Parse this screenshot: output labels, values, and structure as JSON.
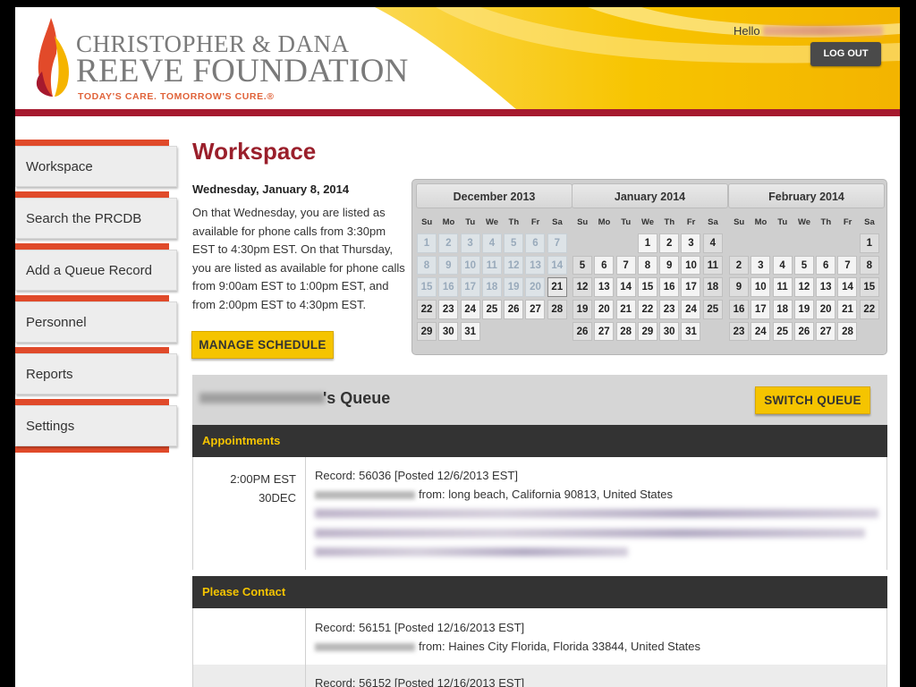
{
  "header": {
    "logo_line1": "CHRISTOPHER & DANA",
    "logo_line2": "REEVE FOUNDATION",
    "logo_tagline": "TODAY'S CARE. TOMORROW'S CURE.®",
    "hello_label": "Hello",
    "logout_label": "LOG OUT",
    "colors": {
      "accent_red": "#a6192e",
      "yellow": "#f5c400",
      "title_red": "#9a1f2b"
    }
  },
  "sidebar": {
    "items": [
      {
        "label": "Workspace"
      },
      {
        "label": "Search the PRCDB"
      },
      {
        "label": "Add a Queue Record"
      },
      {
        "label": "Personnel"
      },
      {
        "label": "Reports"
      },
      {
        "label": "Settings"
      }
    ]
  },
  "main": {
    "title": "Workspace",
    "date_heading": "Wednesday, January 8, 2014",
    "availability_text": "On that Wednesday, you are listed as available for phone calls from 3:30pm EST to 4:30pm EST. On that Thursday, you are listed as available for phone calls from 9:00am EST to 1:00pm EST, and from 2:00pm EST to 4:30pm EST.",
    "manage_schedule_label": "MANAGE SCHEDULE"
  },
  "calendar": {
    "weekday_labels": [
      "Su",
      "Mo",
      "Tu",
      "We",
      "Th",
      "Fr",
      "Sa"
    ],
    "months": [
      {
        "title": "December 2013",
        "first_weekday": 0,
        "days": 31,
        "past_until": 20,
        "today": 21
      },
      {
        "title": "January 2014",
        "first_weekday": 3,
        "days": 31
      },
      {
        "title": "February 2014",
        "first_weekday": 6,
        "days": 28
      }
    ]
  },
  "queue": {
    "title_suffix": "'s Queue",
    "switch_label": "SWITCH QUEUE",
    "sections": {
      "appointments": "Appointments",
      "please_contact": "Please Contact"
    },
    "appointments": [
      {
        "time": "2:00PM EST",
        "date": "30DEC",
        "record": "Record: 56036 [Posted 12/6/2013 EST]",
        "from": "from: long beach, California 90813, United States"
      }
    ],
    "please_contact": [
      {
        "record": "Record: 56151 [Posted 12/16/2013 EST]",
        "from": "from: Haines City Florida, Florida 33844, United States"
      },
      {
        "record": "Record: 56152 [Posted 12/16/2013 EST]"
      }
    ]
  }
}
